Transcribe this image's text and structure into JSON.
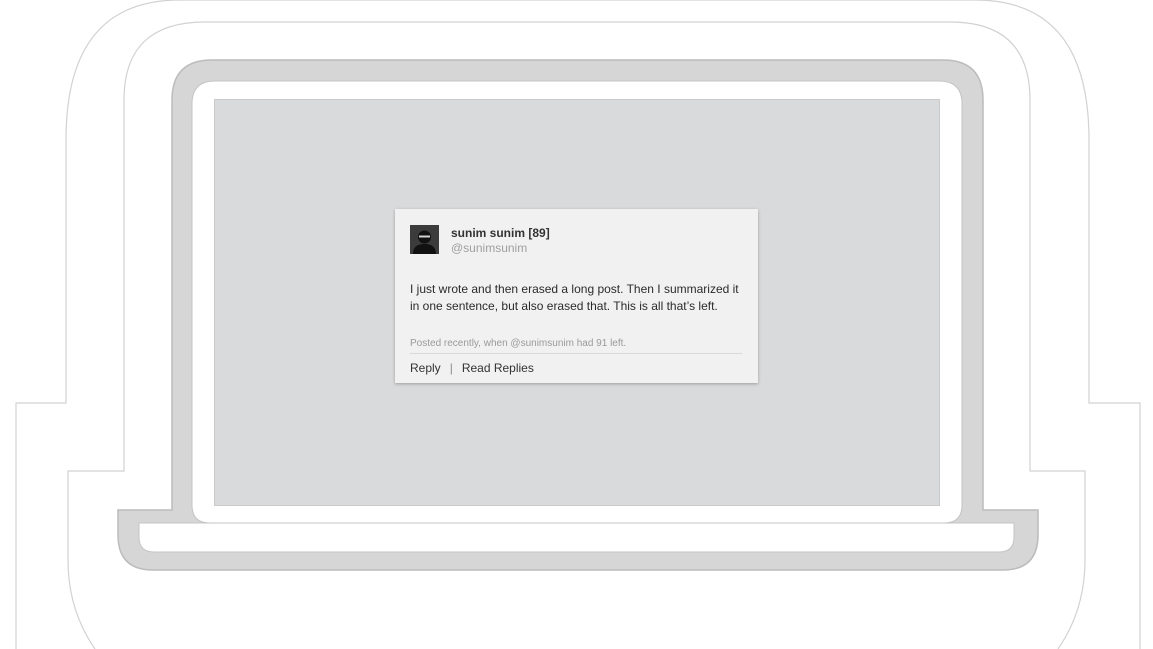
{
  "post": {
    "author_name": "sunim sunim [89]",
    "author_handle": "@sunimsunim",
    "text": "I just wrote and then erased a long post. Then I summarized it in one sentence, but also erased that. This is all that’s left.",
    "meta": "Posted recently, when @sunimsunim had 91 left.",
    "avatar_icon": "user-silhouette-icon"
  },
  "actions": {
    "reply_label": "Reply",
    "separator": "|",
    "read_replies_label": "Read Replies"
  },
  "colors": {
    "screen": "#d9dadb",
    "card": "#f1f1f1",
    "frame_outline": "#bdbdbd",
    "frame_fill": "#d6d6d6"
  }
}
